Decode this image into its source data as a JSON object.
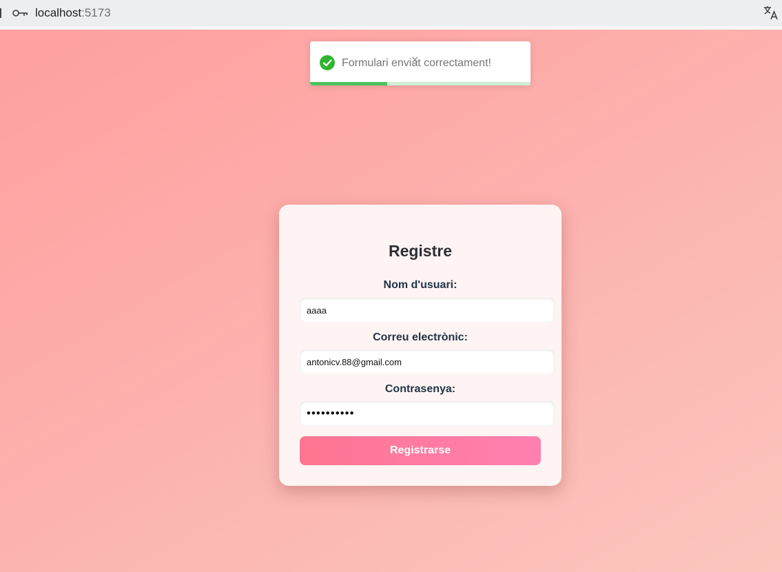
{
  "browser": {
    "url_host": "localhost",
    "url_port": ":5173",
    "icons": [
      "key-icon",
      "translate-icon"
    ]
  },
  "toast": {
    "message": "Formulari enviat correctament!",
    "close_glyph": "✕",
    "progress_fraction": 0.35,
    "icon": "check-circle-icon",
    "colors": {
      "success": "#4cc35c",
      "track": "#cdeed4"
    }
  },
  "form": {
    "title": "Registre",
    "fields": [
      {
        "label": "Nom d'usuari:",
        "value": "aaaa",
        "type": "text"
      },
      {
        "label": "Correu electrònic:",
        "value": "antonicv.88@gmail.com",
        "type": "email"
      },
      {
        "label": "Contrasenya:",
        "value": "••••••••••",
        "type": "password"
      }
    ],
    "submit_label": "Registrarse"
  },
  "colors": {
    "background_from": "#ff9f9f",
    "background_to": "#fbc6bd",
    "button_from": "#ff7592",
    "button_to": "#ff80b0",
    "label": "#233447"
  }
}
